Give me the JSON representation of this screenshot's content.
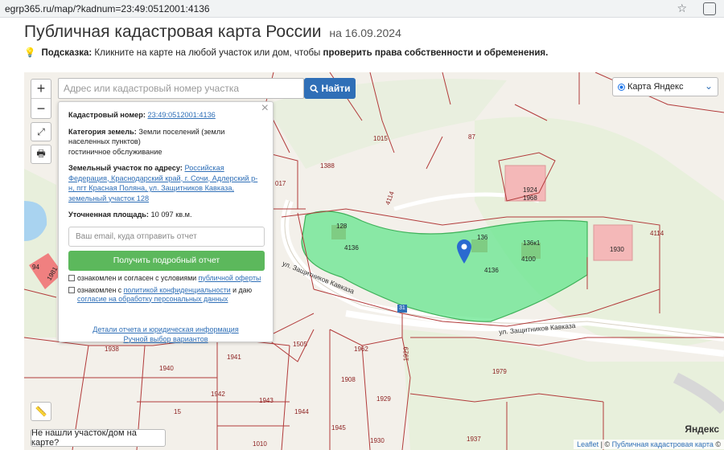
{
  "browser": {
    "url": "egrp365.ru/map/?kadnum=23:49:0512001:4136"
  },
  "header": {
    "title": "Публичная кадастровая карта России",
    "date": "на 16.09.2024",
    "hint_label": "Подсказка:",
    "hint_text": "Кликните на карте на любой участок или дом, чтобы",
    "hint_bold": "проверить права собственности и обременения."
  },
  "map": {
    "search_placeholder": "Адрес или кадастровый номер участка",
    "find_label": "Найти",
    "layer_label": "Карта Яндекс",
    "zoom_in": "+",
    "zoom_out": "−",
    "not_found_label": "Не нашли участок/дом на карте?",
    "yandex_logo": "Яндекс",
    "attribution_leaflet": "Leaflet",
    "attribution_sep": "| ©",
    "attribution_pkk": "Публичная кадастровая карта",
    "attribution_tail": "©",
    "parcel_labels": [
      "1015",
      "87",
      "1388",
      "4114",
      "017",
      "1924",
      "1968",
      "4114",
      "128",
      "4136",
      "136",
      "136к1",
      "4100",
      "4136",
      "1930",
      "1505",
      "1962",
      "1929",
      "1938",
      "1941",
      "1940",
      "1908",
      "1979",
      "1942",
      "1929",
      "15",
      "1944",
      "1943",
      "1945",
      "1930",
      "1937",
      "1010",
      "94",
      "1981"
    ],
    "streets": [
      "ул. Защитников Кавказа",
      "ул. Защитников Кавказа"
    ],
    "road_number": "31"
  },
  "popup": {
    "cadnum_label": "Кадастровый номер:",
    "cadnum_value": "23:49:0512001:4136",
    "category_label": "Категория земель:",
    "category_value": "Земли поселений (земли населенных пунктов)",
    "category_use": "гостиничное обслуживание",
    "address_label": "Земельный участок по адресу:",
    "address_value": "Российская Федерация, Краснодарский край, г. Сочи, Адлерский р-н, пгт Красная Поляна, ул. Защитников Кавказа, земельный участок 128",
    "area_label": "Уточненная площадь:",
    "area_value": "10 097 кв.м.",
    "email_placeholder": "Ваш email, куда отправить отчет",
    "report_button": "Получить подробный отчет",
    "consent1_text": "ознакомлен и согласен с условиями",
    "consent1_link": "публичной оферты",
    "consent2_text": "ознакомлен с",
    "consent2_link1": "политикой конфиденциальности",
    "consent2_mid": "и даю",
    "consent2_link2": "согласие на обработку персональных данных",
    "link_details": "Детали отчета и юридическая информация",
    "link_manual": "Ручной выбор вариантов"
  }
}
